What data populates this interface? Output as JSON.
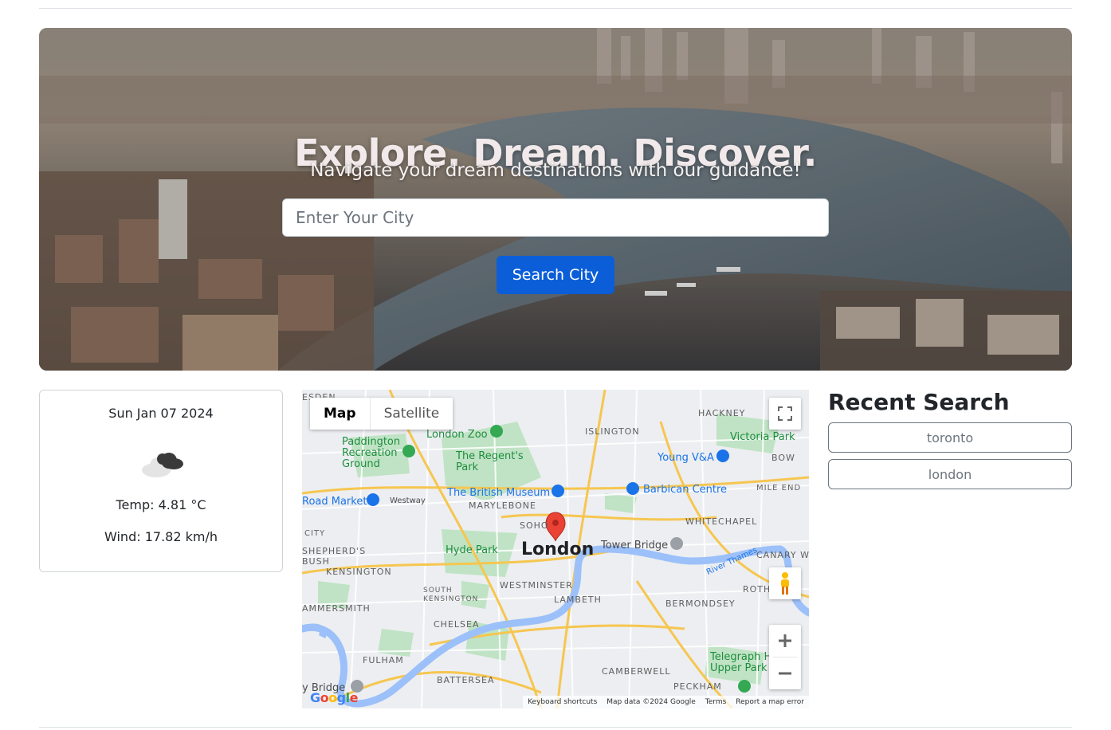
{
  "hero": {
    "title": "Explore. Dream. Discover.",
    "subtitle": "Navigate your dream destinations with our guidance!",
    "input_placeholder": "Enter Your City",
    "search_button": "Search City"
  },
  "weather": {
    "date": "Sun Jan 07 2024",
    "icon": "cloud-icon",
    "temp": "Temp: 4.81 °C",
    "wind": "Wind: 17.82 km/h"
  },
  "map": {
    "tabs": [
      "Map",
      "Satellite"
    ],
    "active_tab": "Map",
    "city_label": "London",
    "labels": {
      "hackney": "HACKNEY",
      "islington": "ISLINGTON",
      "victoria_park": "Victoria Park",
      "bow": "BOW",
      "paddington": "Paddington\nRecreation\nGround",
      "london_zoo": "London Zoo",
      "regents_park": "The Regent's\nPark",
      "young_va": "Young V&A",
      "british_museum": "The British Museum",
      "barbican": "Barbican Centre",
      "marylebone": "MARYLEBONE",
      "road_market": "Road Market",
      "westway": "Westway",
      "mile_end": "MILE END",
      "soho": "SOHO",
      "whitechapel": "WHITECHAPEL",
      "city": "CITY",
      "shepherds_bush": "SHEPHERD'S\nBUSH",
      "hyde_park": "Hyde Park",
      "tower_bridge": "Tower Bridge",
      "canary": "CANARY W",
      "kensington": "KENSINGTON",
      "westminster": "WESTMINSTER",
      "south_kensington": "SOUTH\nKENSINGTON",
      "lambeth": "LAMBETH",
      "rotherh": "ROTHERH",
      "hammersmith": "AMMERSMITH",
      "bermondsey": "BERMONDSEY",
      "chelsea": "CHELSEA",
      "fulham": "FULHAM",
      "camberwell": "CAMBERWELL",
      "telegraph": "Telegraph H\nUpper Park",
      "battersea": "BATTERSEA",
      "peckham": "PECKHAM",
      "river_thames": "River Thames",
      "esden": "ESDEN",
      "bridge": "y Bridge"
    },
    "attribution": [
      "Keyboard shortcuts",
      "Map data ©2024 Google",
      "Terms",
      "Report a map error"
    ],
    "logo": "Google"
  },
  "recent": {
    "title": "Recent Search",
    "items": [
      "toronto",
      "london"
    ]
  }
}
